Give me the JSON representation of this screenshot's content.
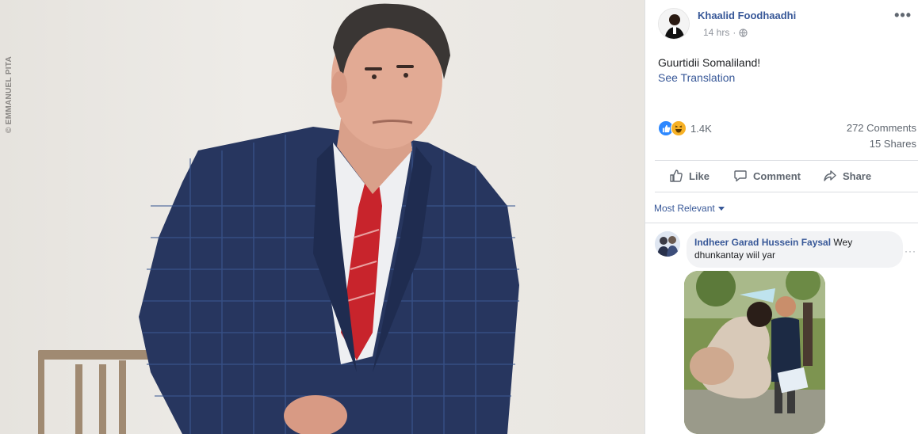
{
  "photo": {
    "credit": "© EMMANUEL PITA"
  },
  "post": {
    "author": "Khaalid Foodhaadhi",
    "time": "14 hrs",
    "separator": "·",
    "privacy_icon": "globe-icon",
    "text": "Guurtidii Somaliland!",
    "translation_link": "See Translation",
    "more_icon": "more-horizontal-icon"
  },
  "stats": {
    "reaction_icons": [
      "like-reaction-icon",
      "haha-reaction-icon"
    ],
    "reaction_count": "1.4K",
    "comments": "272 Comments",
    "shares": "15 Shares"
  },
  "actions": {
    "like": "Like",
    "comment": "Comment",
    "share": "Share"
  },
  "comments_section": {
    "sort_label": "Most Relevant",
    "comment": {
      "author": "Indheer Garad Hussein Faysal",
      "text": " Wey dhunkantay wiil yar",
      "more_icon": "more-horizontal-icon"
    }
  },
  "colors": {
    "link": "#385898",
    "secondary_text": "#606770",
    "like_blue": "#2d88ff",
    "haha_yellow": "#f7b125"
  }
}
